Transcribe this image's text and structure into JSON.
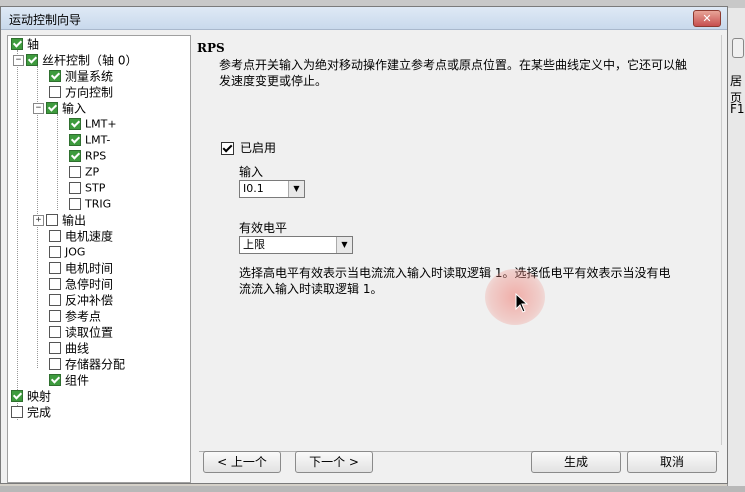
{
  "dialog": {
    "title": "运动控制向导",
    "close_label": "✕"
  },
  "background": {
    "right_text_1": "居页",
    "right_text_2": "F1"
  },
  "tree": {
    "items": [
      {
        "label": "轴",
        "checked": true
      },
      {
        "label": "丝杆控制（轴 0）",
        "checked": true
      },
      {
        "label": "测量系统",
        "checked": true
      },
      {
        "label": "方向控制",
        "checked": false
      },
      {
        "label": "输入",
        "checked": true
      },
      {
        "label": "LMT+",
        "checked": true
      },
      {
        "label": "LMT-",
        "checked": true
      },
      {
        "label": "RPS",
        "checked": true
      },
      {
        "label": "ZP",
        "checked": false
      },
      {
        "label": "STP",
        "checked": false
      },
      {
        "label": "TRIG",
        "checked": false
      },
      {
        "label": "输出",
        "checked": false
      },
      {
        "label": "电机速度",
        "checked": false
      },
      {
        "label": "JOG",
        "checked": false
      },
      {
        "label": "电机时间",
        "checked": false
      },
      {
        "label": "急停时间",
        "checked": false
      },
      {
        "label": "反冲补偿",
        "checked": false
      },
      {
        "label": "参考点",
        "checked": false
      },
      {
        "label": "读取位置",
        "checked": false
      },
      {
        "label": "曲线",
        "checked": false
      },
      {
        "label": "存储器分配",
        "checked": false
      },
      {
        "label": "组件",
        "checked": true
      },
      {
        "label": "映射",
        "checked": true
      },
      {
        "label": "完成",
        "checked": false
      }
    ]
  },
  "content": {
    "title": "RPS",
    "description": "参考点开关输入为绝对移动操作建立参考点或原点位置。在某些曲线定义中，它还可以触发速度变更或停止。",
    "enabled_label": "已启用",
    "input_label": "输入",
    "input_value": "I0.1",
    "level_label": "有效电平",
    "level_value": "上限",
    "note": "选择高电平有效表示当电流流入输入时读取逻辑 1。选择低电平有效表示当没有电流流入输入时读取逻辑 1。"
  },
  "buttons": {
    "prev": "< 上一个",
    "next": "下一个 >",
    "finish": "生成",
    "cancel": "取消"
  }
}
